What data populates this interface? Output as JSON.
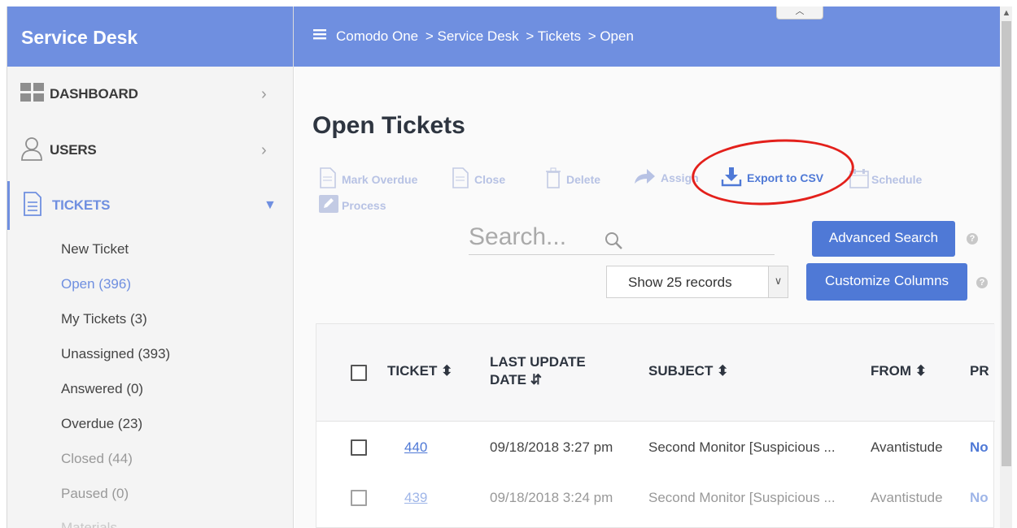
{
  "sidebar": {
    "brand": "Service Desk",
    "nav": [
      {
        "label": "DASHBOARD",
        "icon": "dashboard-icon"
      },
      {
        "label": "USERS",
        "icon": "user-icon"
      },
      {
        "label": "TICKETS",
        "icon": "document-icon"
      }
    ],
    "ticket_links": [
      "New Ticket",
      "Open (396)",
      "My Tickets (3)",
      "Unassigned (393)",
      "Answered (0)",
      "Overdue (23)",
      "Closed (44)",
      "Paused (0)",
      "Materials"
    ]
  },
  "header": {
    "breadcrumb": [
      "Comodo One",
      "> Service Desk",
      "> Tickets",
      "> Open"
    ]
  },
  "main": {
    "title": "Open Tickets",
    "toolbar": {
      "mark_overdue": "Mark Overdue",
      "close": "Close",
      "delete": "Delete",
      "assign": "Assign",
      "export": "Export to CSV",
      "schedule": "Schedule",
      "process": "Process"
    },
    "search_placeholder": "Search...",
    "advanced_search": "Advanced Search",
    "records_select": "Show 25 records",
    "customize_columns": "Customize Columns",
    "help_glyph": "?"
  },
  "table": {
    "headers": {
      "ticket": "TICKET",
      "last_update_1": "LAST UPDATE",
      "last_update_2": "DATE",
      "subject": "SUBJECT",
      "from": "FROM",
      "priority": "PR"
    },
    "rows": [
      {
        "ticket": "440",
        "date": "09/18/2018 3:27 pm",
        "subject": "Second Monitor [Suspicious ...",
        "from": "Avantistude",
        "priority": "No"
      },
      {
        "ticket": "439",
        "date": "09/18/2018 3:24 pm",
        "subject": "Second Monitor [Suspicious ...",
        "from": "Avantistude",
        "priority": "No"
      }
    ]
  },
  "colors": {
    "accent": "#6f8fe0",
    "button": "#4f79d6",
    "highlight_ellipse": "#e3201b"
  }
}
